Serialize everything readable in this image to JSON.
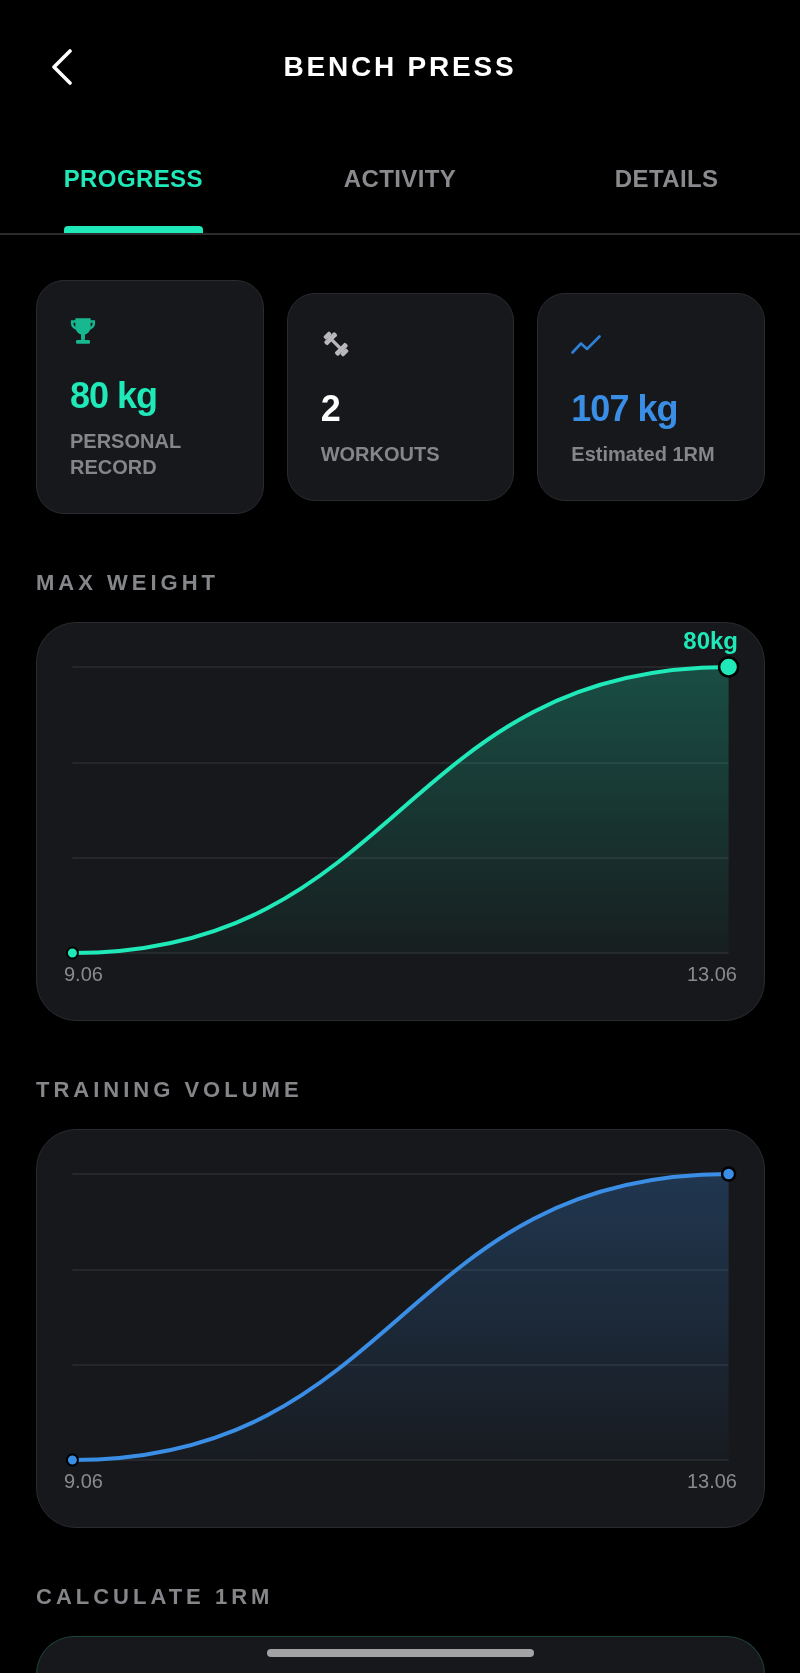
{
  "header": {
    "title": "BENCH PRESS"
  },
  "tabs": [
    {
      "label": "PROGRESS",
      "selected": true
    },
    {
      "label": "ACTIVITY",
      "selected": false
    },
    {
      "label": "DETAILS",
      "selected": false
    }
  ],
  "stats": [
    {
      "kind": "trophy",
      "value": "80 kg",
      "label": "PERSONAL RECORD",
      "color": "#1fe8b9"
    },
    {
      "kind": "dumbbell",
      "value": "2",
      "label": "WORKOUTS",
      "color": "#ffffff"
    },
    {
      "kind": "trend",
      "value": "107 kg",
      "label": "Estimated 1RM",
      "color": "#3a8ee6"
    }
  ],
  "charts": [
    {
      "title": "MAX WEIGHT",
      "color": "#1fe8b9",
      "peak_label": "80kg",
      "x_labels": [
        "9.06",
        "13.06"
      ]
    },
    {
      "title": "TRAINING VOLUME",
      "color": "#3a8ee6",
      "x_labels": [
        "9.06",
        "13.06"
      ]
    }
  ],
  "calculator": {
    "title": "CALCULATE 1RM"
  }
}
